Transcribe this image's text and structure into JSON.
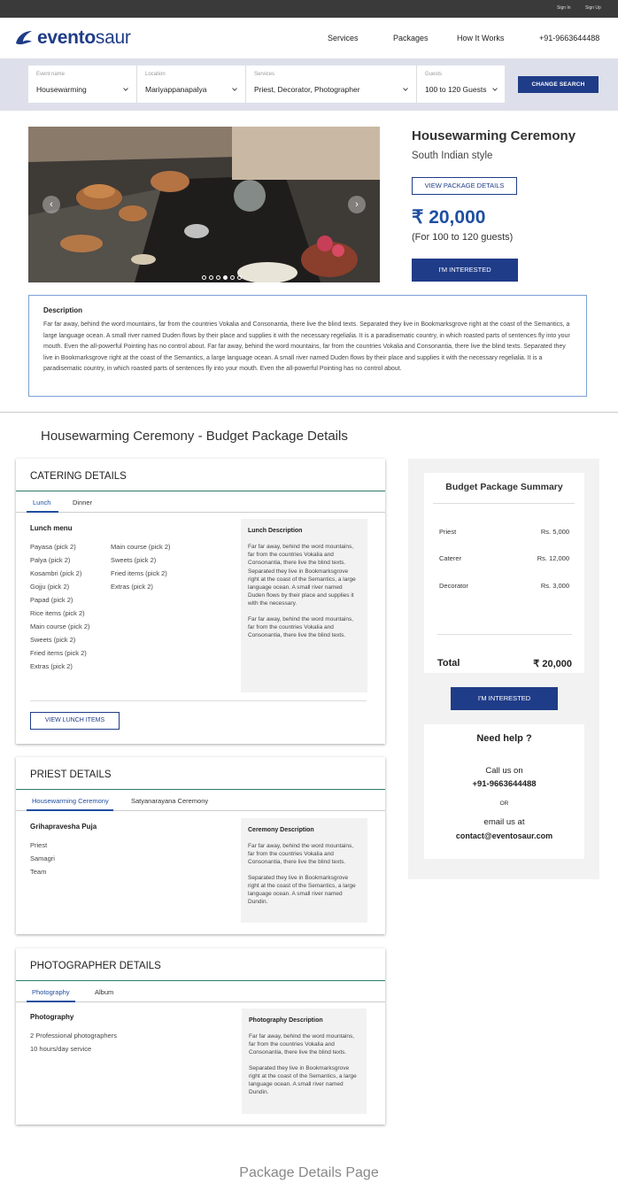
{
  "topbar": {
    "sign_in": "Sign In",
    "sign_up": "Sign Up"
  },
  "header": {
    "logo_bold": "evento",
    "logo_light": "saur",
    "nav": [
      "Services",
      "Packages",
      "How It Works",
      "+91-9663644488"
    ]
  },
  "search": {
    "fields": [
      {
        "label": "Event name",
        "value": "Housewarming"
      },
      {
        "label": "Location",
        "value": "Mariyappanapalya"
      },
      {
        "label": "Services",
        "value": "Priest, Decorator, Photographer"
      },
      {
        "label": "Guests",
        "value": "100 to 120 Guests"
      }
    ],
    "change_button": "CHANGE SEARCH"
  },
  "package": {
    "title": "Housewarming Ceremony",
    "subtitle": "South Indian style",
    "view_details": "VIEW PACKAGE DETAILS",
    "price": "₹ 20,000",
    "price_note": "(For 100 to 120 guests)",
    "interested": "I'M INTERESTED",
    "carousel": {
      "total": 6,
      "active": 3
    }
  },
  "description": {
    "heading": "Description",
    "text": "Far far away, behind the word mountains, far from the countries Vokalia and Consonantia, there live the blind texts. Separated they live in Bookmarksgrove right at the coast of the Semantics, a large language ocean. A small river named Duden flows by their place and supplies it with the necessary regelialia. It is a paradisematic country, in which roasted parts of sentences fly into your mouth. Even the all-powerful Pointing has no control about. Far far away, behind the word mountains, far from the countries Vokalia and Consonantia, there live the blind texts. Separated they live in Bookmarksgrove right at the coast of the Semantics, a large language ocean. A small river named Duden flows by their place and supplies it with the necessary regelialia. It is a paradisematic country, in which roasted parts of sentences fly into your mouth. Even the all-powerful Pointing has no control about."
  },
  "budget_title": "Housewarming Ceremony - Budget Package Details",
  "catering": {
    "heading": "CATERING DETAILS",
    "tabs": [
      "Lunch",
      "Dinner"
    ],
    "menu_title": "Lunch menu",
    "col1": [
      "Payasa (pick 2)",
      "Palya (pick 2)",
      "Kosambri (pick 2)",
      "Gojju (pick 2)",
      "Papad (pick 2)",
      "Rice items (pick 2)",
      "Main course (pick 2)",
      "Sweets (pick 2)",
      "Fried items (pick 2)",
      "Extras (pick 2)"
    ],
    "col2": [
      "Main course (pick 2)",
      "Sweets (pick 2)",
      "Fried items (pick 2)",
      "Extras (pick 2)"
    ],
    "box_title": "Lunch Description",
    "box_p1": "Far far away, behind the word mountains, far from the countries Vokalia and Consonantia, there live the blind texts. Separated they live in Bookmarksgrove right at the coast of the Semantics, a large language ocean. A small river named Duden flows by their place and supplies it with the necessary.",
    "box_p2": "Far far away, behind the word mountains, far from the countries Vokalia and Consonantia, there live the blind texts.",
    "view_button": "VIEW LUNCH ITEMS"
  },
  "priest": {
    "heading": "PRIEST DETAILS",
    "tabs": [
      "Housewarming Ceremony",
      "Satyanarayana Ceremony"
    ],
    "list_title": "Grihapravesha Puja",
    "items": [
      "Priest",
      "Samagri",
      "Team"
    ],
    "box_title": "Ceremony Description",
    "box_p1": "Far far away, behind the word mountains, far from the countries Vokalia and Consonantia, there live the blind texts.",
    "box_p2": "Separated they live in Bookmarksgrove right at the coast of the Semantics, a large language ocean. A small river named Dundin."
  },
  "photographer": {
    "heading": "PHOTOGRAPHER DETAILS",
    "tabs": [
      "Photography",
      "Album"
    ],
    "list_title": "Photography",
    "items": [
      "2 Professional photographers",
      "10 hours/day service"
    ],
    "box_title": "Photography Description",
    "box_p1": "Far far away, behind the word mountains, far from the countries Vokalia and Consonantia, there live the blind texts.",
    "box_p2": "Separated they live in Bookmarksgrove right at the coast of the Semantics, a large language ocean. A small river named Dundin."
  },
  "summary": {
    "title": "Budget Package Summary",
    "rows": [
      {
        "label": "Priest",
        "value": "Rs. 5,000"
      },
      {
        "label": "Caterer",
        "value": "Rs. 12,000"
      },
      {
        "label": "Decorator",
        "value": "Rs. 3,000"
      }
    ],
    "total_label": "Total",
    "total_value": "₹ 20,000",
    "interested": "I'M INTERESTED"
  },
  "help": {
    "title": "Need help ?",
    "call": "Call us on",
    "phone": "+91-9663644488",
    "or": "OR",
    "email_label": "email us at",
    "email": "contact@eventosaur.com"
  },
  "caption": "Package Details Page",
  "colors": {
    "brand": "#1f3c88",
    "accent_link": "#1f4fa0",
    "tab_rule": "#2d7a6a"
  }
}
